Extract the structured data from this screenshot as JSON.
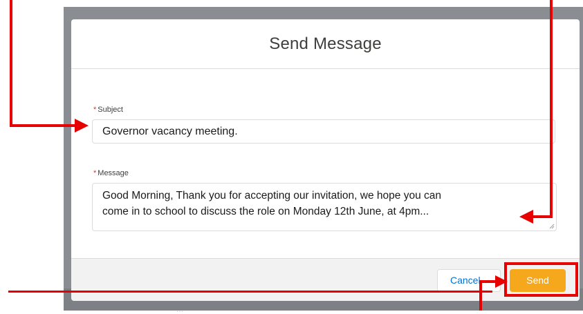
{
  "dialog": {
    "title": "Send Message",
    "subject_label": "Subject",
    "subject_value": "Governor vacancy meeting.",
    "message_label": "Message",
    "message_line1": "Good Morning, Thank you for accepting our invitation, we hope you can",
    "message_line2": "come in to school to discuss the role on Monday 12th June, at 4pm...",
    "required_marker": "*",
    "cancel_label": "Cancel",
    "send_label": "Send"
  },
  "background": {
    "peek_text": "..."
  },
  "colors": {
    "accent_send": "#f5a81c",
    "annotation_red": "#e60000",
    "link_blue": "#0070d2",
    "backdrop_gray": "#8a8d91"
  },
  "annotations": {
    "arrow_icons": [
      "arrow-to-subject-icon",
      "arrow-to-message-icon",
      "arrow-to-send-icon"
    ],
    "highlight_target": "send-button"
  }
}
